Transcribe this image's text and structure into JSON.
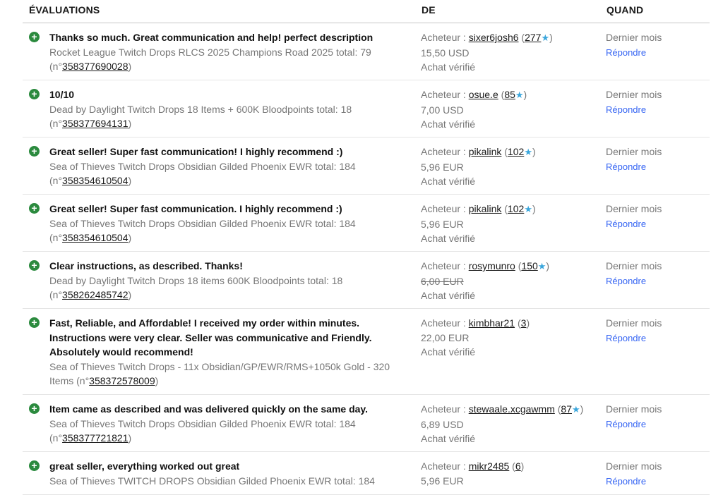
{
  "header": {
    "evaluations": "ÉVALUATIONS",
    "from": "DE",
    "when": "QUAND"
  },
  "rows": [
    {
      "comment": "Thanks so much. Great communication and help! perfect description",
      "item": "Rocket League Twitch Drops RLCS 2025 Champions Road 2025 total: 79",
      "item_no": "358377690028",
      "role": "Acheteur : ",
      "user": "sixer6josh6",
      "score": "277",
      "star": true,
      "price": "15,50 USD",
      "price_struck": false,
      "verified": "Achat vérifié",
      "when": "Dernier mois",
      "reply": "Répondre"
    },
    {
      "comment": "10/10",
      "item": "Dead by Daylight Twitch Drops 18 Items + 600K Bloodpoints total: 18",
      "item_no": "358377694131",
      "role": "Acheteur : ",
      "user": "osue.e",
      "score": "85",
      "star": true,
      "price": "7,00 USD",
      "price_struck": false,
      "verified": "Achat vérifié",
      "when": "Dernier mois",
      "reply": "Répondre"
    },
    {
      "comment": "Great seller! Super fast communication! I highly recommend :)",
      "item": "Sea of Thieves Twitch Drops Obsidian Gilded Phoenix EWR total: 184",
      "item_no": "358354610504",
      "role": "Acheteur : ",
      "user": "pikalink",
      "score": "102",
      "star": true,
      "price": "5,96 EUR",
      "price_struck": false,
      "verified": "Achat vérifié",
      "when": "Dernier mois",
      "reply": "Répondre"
    },
    {
      "comment": "Great seller! Super fast communication. I highly recommend :)",
      "item": "Sea of Thieves Twitch Drops Obsidian Gilded Phoenix EWR total: 184",
      "item_no": "358354610504",
      "role": "Acheteur : ",
      "user": "pikalink",
      "score": "102",
      "star": true,
      "price": "5,96 EUR",
      "price_struck": false,
      "verified": "Achat vérifié",
      "when": "Dernier mois",
      "reply": "Répondre"
    },
    {
      "comment": "Clear instructions, as described. Thanks!",
      "item": "Dead by Daylight Twitch Drops 18 items 600K Bloodpoints total: 18",
      "item_no": "358262485742",
      "role": "Acheteur : ",
      "user": "rosymunro",
      "score": "150",
      "star": true,
      "price": "6,00 EUR",
      "price_struck": true,
      "verified": "Achat vérifié",
      "when": "Dernier mois",
      "reply": "Répondre"
    },
    {
      "comment": "Fast, Reliable, and Affordable! I received my order within minutes. Instructions were very clear. Seller was communicative and Friendly. Absolutely would recommend!",
      "item": "Sea of Thieves Twitch Drops - 11x Obsidian/GP/EWR/RMS+1050k Gold - 320 Items",
      "item_no": "358372578009",
      "role": "Acheteur : ",
      "user": "kimbhar21",
      "score": "3",
      "star": false,
      "price": "22,00 EUR",
      "price_struck": false,
      "verified": "Achat vérifié",
      "when": "Dernier mois",
      "reply": "Répondre"
    },
    {
      "comment": "Item came as described and was delivered quickly on the same day.",
      "item": "Sea of Thieves Twitch Drops Obsidian Gilded Phoenix EWR total: 184",
      "item_no": "358377721821",
      "role": "Acheteur : ",
      "user": "stewaale.xcgawmm",
      "score": "87",
      "star": true,
      "price": "6,89 USD",
      "price_struck": false,
      "verified": "Achat vérifié",
      "when": "Dernier mois",
      "reply": "Répondre"
    },
    {
      "comment": "great seller, everything worked out great",
      "item": "Sea of Thieves TWITCH DROPS Obsidian Gilded Phoenix EWR total: 184",
      "item_no": "",
      "role": "Acheteur : ",
      "user": "mikr2485",
      "score": "6",
      "star": false,
      "price": "5,96 EUR",
      "price_struck": false,
      "verified": "",
      "when": "Dernier mois",
      "reply": "Répondre"
    }
  ],
  "icons": {
    "positive": "plus-circle-icon",
    "star": "star-icon"
  },
  "colors": {
    "positive": "#2b8a3e",
    "star": "#3aa6dc",
    "reply_link": "#3665f3"
  }
}
